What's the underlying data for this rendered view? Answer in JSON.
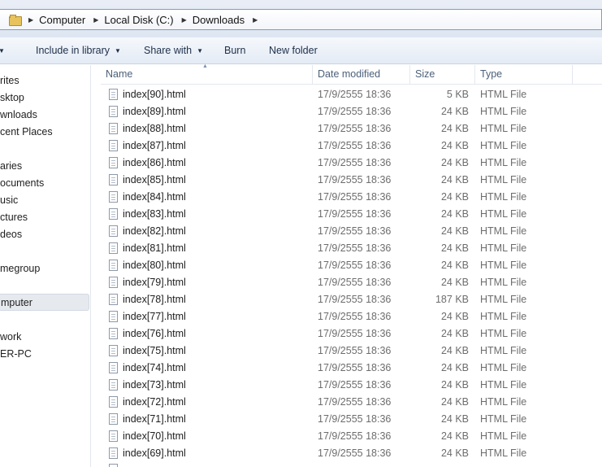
{
  "address_bar": {
    "crumbs": [
      "Computer",
      "Local Disk (C:)",
      "Downloads"
    ]
  },
  "toolbar": {
    "include_label": "Include in library",
    "share_label": "Share with",
    "burn_label": "Burn",
    "new_folder_label": "New folder"
  },
  "nav": {
    "items": [
      "rites",
      "sktop",
      "wnloads",
      "cent Places",
      "aries",
      "ocuments",
      "usic",
      "ctures",
      "deos",
      "megroup",
      "mputer",
      "work",
      "ER-PC"
    ]
  },
  "columns": {
    "name": "Name",
    "date": "Date modified",
    "size": "Size",
    "type": "Type"
  },
  "files": [
    {
      "name": "index[90].html",
      "date": "17/9/2555 18:36",
      "size": "5 KB",
      "type": "HTML File"
    },
    {
      "name": "index[89].html",
      "date": "17/9/2555 18:36",
      "size": "24 KB",
      "type": "HTML File"
    },
    {
      "name": "index[88].html",
      "date": "17/9/2555 18:36",
      "size": "24 KB",
      "type": "HTML File"
    },
    {
      "name": "index[87].html",
      "date": "17/9/2555 18:36",
      "size": "24 KB",
      "type": "HTML File"
    },
    {
      "name": "index[86].html",
      "date": "17/9/2555 18:36",
      "size": "24 KB",
      "type": "HTML File"
    },
    {
      "name": "index[85].html",
      "date": "17/9/2555 18:36",
      "size": "24 KB",
      "type": "HTML File"
    },
    {
      "name": "index[84].html",
      "date": "17/9/2555 18:36",
      "size": "24 KB",
      "type": "HTML File"
    },
    {
      "name": "index[83].html",
      "date": "17/9/2555 18:36",
      "size": "24 KB",
      "type": "HTML File"
    },
    {
      "name": "index[82].html",
      "date": "17/9/2555 18:36",
      "size": "24 KB",
      "type": "HTML File"
    },
    {
      "name": "index[81].html",
      "date": "17/9/2555 18:36",
      "size": "24 KB",
      "type": "HTML File"
    },
    {
      "name": "index[80].html",
      "date": "17/9/2555 18:36",
      "size": "24 KB",
      "type": "HTML File"
    },
    {
      "name": "index[79].html",
      "date": "17/9/2555 18:36",
      "size": "24 KB",
      "type": "HTML File"
    },
    {
      "name": "index[78].html",
      "date": "17/9/2555 18:36",
      "size": "187 KB",
      "type": "HTML File"
    },
    {
      "name": "index[77].html",
      "date": "17/9/2555 18:36",
      "size": "24 KB",
      "type": "HTML File"
    },
    {
      "name": "index[76].html",
      "date": "17/9/2555 18:36",
      "size": "24 KB",
      "type": "HTML File"
    },
    {
      "name": "index[75].html",
      "date": "17/9/2555 18:36",
      "size": "24 KB",
      "type": "HTML File"
    },
    {
      "name": "index[74].html",
      "date": "17/9/2555 18:36",
      "size": "24 KB",
      "type": "HTML File"
    },
    {
      "name": "index[73].html",
      "date": "17/9/2555 18:36",
      "size": "24 KB",
      "type": "HTML File"
    },
    {
      "name": "index[72].html",
      "date": "17/9/2555 18:36",
      "size": "24 KB",
      "type": "HTML File"
    },
    {
      "name": "index[71].html",
      "date": "17/9/2555 18:36",
      "size": "24 KB",
      "type": "HTML File"
    },
    {
      "name": "index[70].html",
      "date": "17/9/2555 18:36",
      "size": "24 KB",
      "type": "HTML File"
    },
    {
      "name": "index[69].html",
      "date": "17/9/2555 18:36",
      "size": "24 KB",
      "type": "HTML File"
    }
  ]
}
